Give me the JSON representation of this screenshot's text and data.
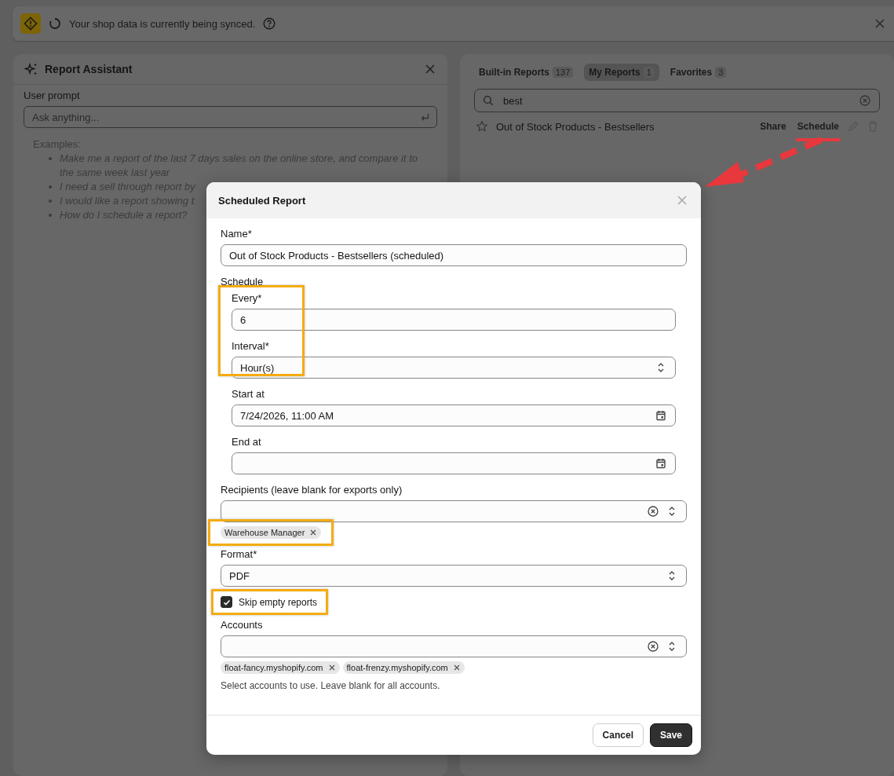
{
  "banner": {
    "message": "Your shop data is currently being synced."
  },
  "assistant": {
    "title": "Report Assistant",
    "prompt_label": "User prompt",
    "prompt": {
      "placeholder": "Ask anything..."
    },
    "examples_label": "Examples:",
    "examples": [
      "Make me a report of the last 7 days sales on the online store, and compare it to the same week last year",
      "I need a sell through report by",
      "I would like a report showing t",
      "How do I schedule a report?"
    ]
  },
  "reports": {
    "tabs": [
      {
        "label": "Built-in Reports",
        "count": "137",
        "selected": false
      },
      {
        "label": "My Reports",
        "count": "1",
        "selected": true
      },
      {
        "label": "Favorites",
        "count": "3",
        "selected": false
      }
    ],
    "search": {
      "value": "best"
    },
    "rows": [
      {
        "name": "Out of Stock Products - Bestsellers",
        "favorite": false,
        "actions": [
          {
            "label": "Share",
            "highlighted": false
          },
          {
            "label": "Schedule",
            "highlighted": true
          }
        ]
      }
    ]
  },
  "dialog": {
    "title": "Scheduled Report",
    "name": {
      "label": "Name*",
      "value": "Out of Stock Products - Bestsellers (scheduled)"
    },
    "schedule": {
      "label": "Schedule",
      "highlighted": true,
      "fields": [
        {
          "kind": "text",
          "label": "Every*",
          "value": "6"
        },
        {
          "kind": "select",
          "label": "Interval*",
          "value": "Hour(s)"
        },
        {
          "kind": "datetime",
          "label": "Start at",
          "value": "7/24/2026, 11:00 AM"
        },
        {
          "kind": "datetime",
          "label": "End at"
        }
      ]
    },
    "recipients": {
      "label": "Recipients (leave blank for exports only)",
      "chips": [
        {
          "label": "Warehouse Manager",
          "highlighted": true
        }
      ]
    },
    "format": {
      "label": "Format*",
      "value": "PDF"
    },
    "skip_empty": {
      "label": "Skip empty reports",
      "checked": true,
      "highlighted": true
    },
    "accounts": {
      "label": "Accounts",
      "chips": [
        {
          "label": "float-fancy.myshopify.com",
          "highlighted": false
        },
        {
          "label": "float-frenzy.myshopify.com",
          "highlighted": false
        }
      ],
      "help": "Select accounts to use. Leave blank for all accounts."
    },
    "buttons": [
      {
        "label": "Cancel",
        "kind": "secondary"
      },
      {
        "label": "Save",
        "kind": "primary"
      }
    ]
  }
}
